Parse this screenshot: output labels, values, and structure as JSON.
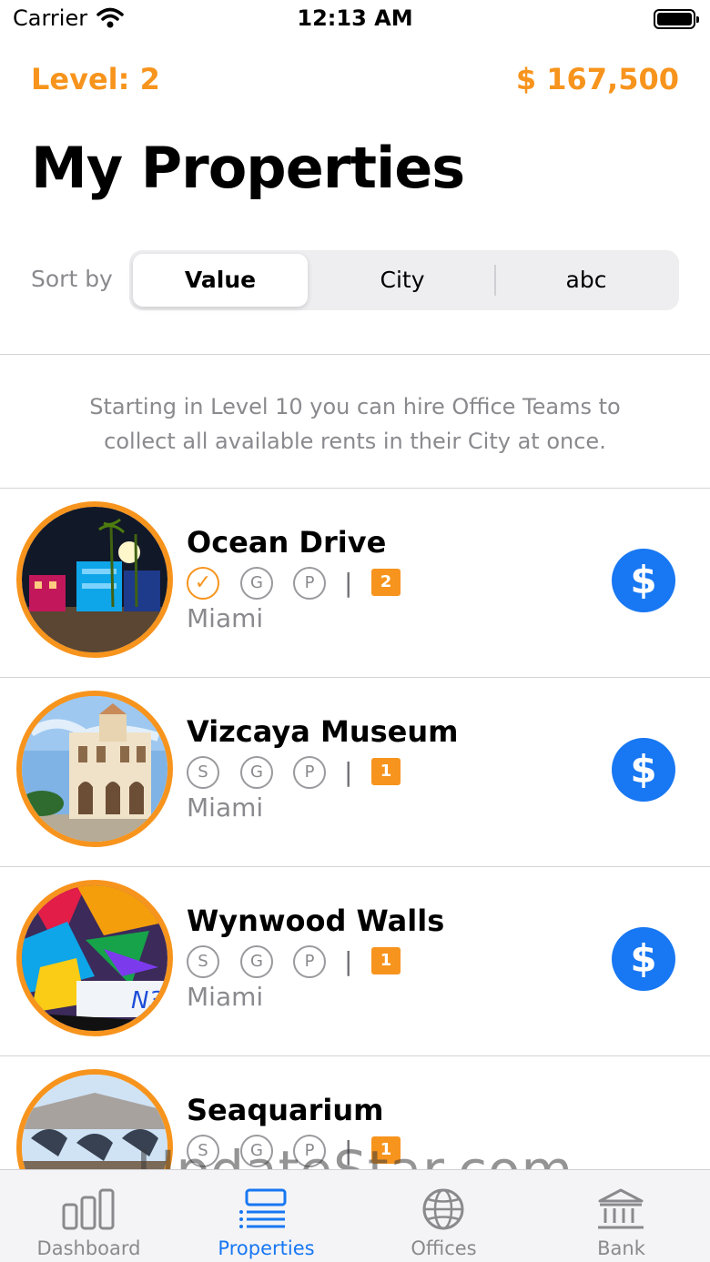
{
  "status_bar": {
    "carrier": "Carrier",
    "time": "12:13 AM"
  },
  "header": {
    "level": "Level: 2",
    "balance": "$ 167,500",
    "title": "My Properties"
  },
  "sort": {
    "label": "Sort by",
    "options": [
      "Value",
      "City",
      "abc"
    ],
    "selected": "Value"
  },
  "info": {
    "text": "Starting in Level 10 you can hire Office Teams to collect all available rents in their City at once."
  },
  "properties": [
    {
      "name": "Ocean Drive",
      "city": "Miami",
      "badges": [
        "check",
        "G",
        "P"
      ],
      "level": "2",
      "collect_icon": "$"
    },
    {
      "name": "Vizcaya Museum",
      "city": "Miami",
      "badges": [
        "S",
        "G",
        "P"
      ],
      "level": "1",
      "collect_icon": "$"
    },
    {
      "name": "Wynwood Walls",
      "city": "Miami",
      "badges": [
        "S",
        "G",
        "P"
      ],
      "level": "1",
      "collect_icon": "$"
    },
    {
      "name": "Seaquarium",
      "city": "",
      "badges": [
        "S",
        "G",
        "P"
      ],
      "level": "1",
      "collect_icon": ""
    }
  ],
  "tabs": [
    {
      "label": "Dashboard",
      "icon": "bar-chart-icon"
    },
    {
      "label": "Properties",
      "icon": "list-icon"
    },
    {
      "label": "Offices",
      "icon": "globe-icon"
    },
    {
      "label": "Bank",
      "icon": "bank-icon"
    }
  ],
  "active_tab": "Properties",
  "watermark": "UpdateStar.com",
  "colors": {
    "accent": "#f7941d",
    "action_blue": "#1877f2",
    "secondary_text": "#8a8a8e"
  }
}
